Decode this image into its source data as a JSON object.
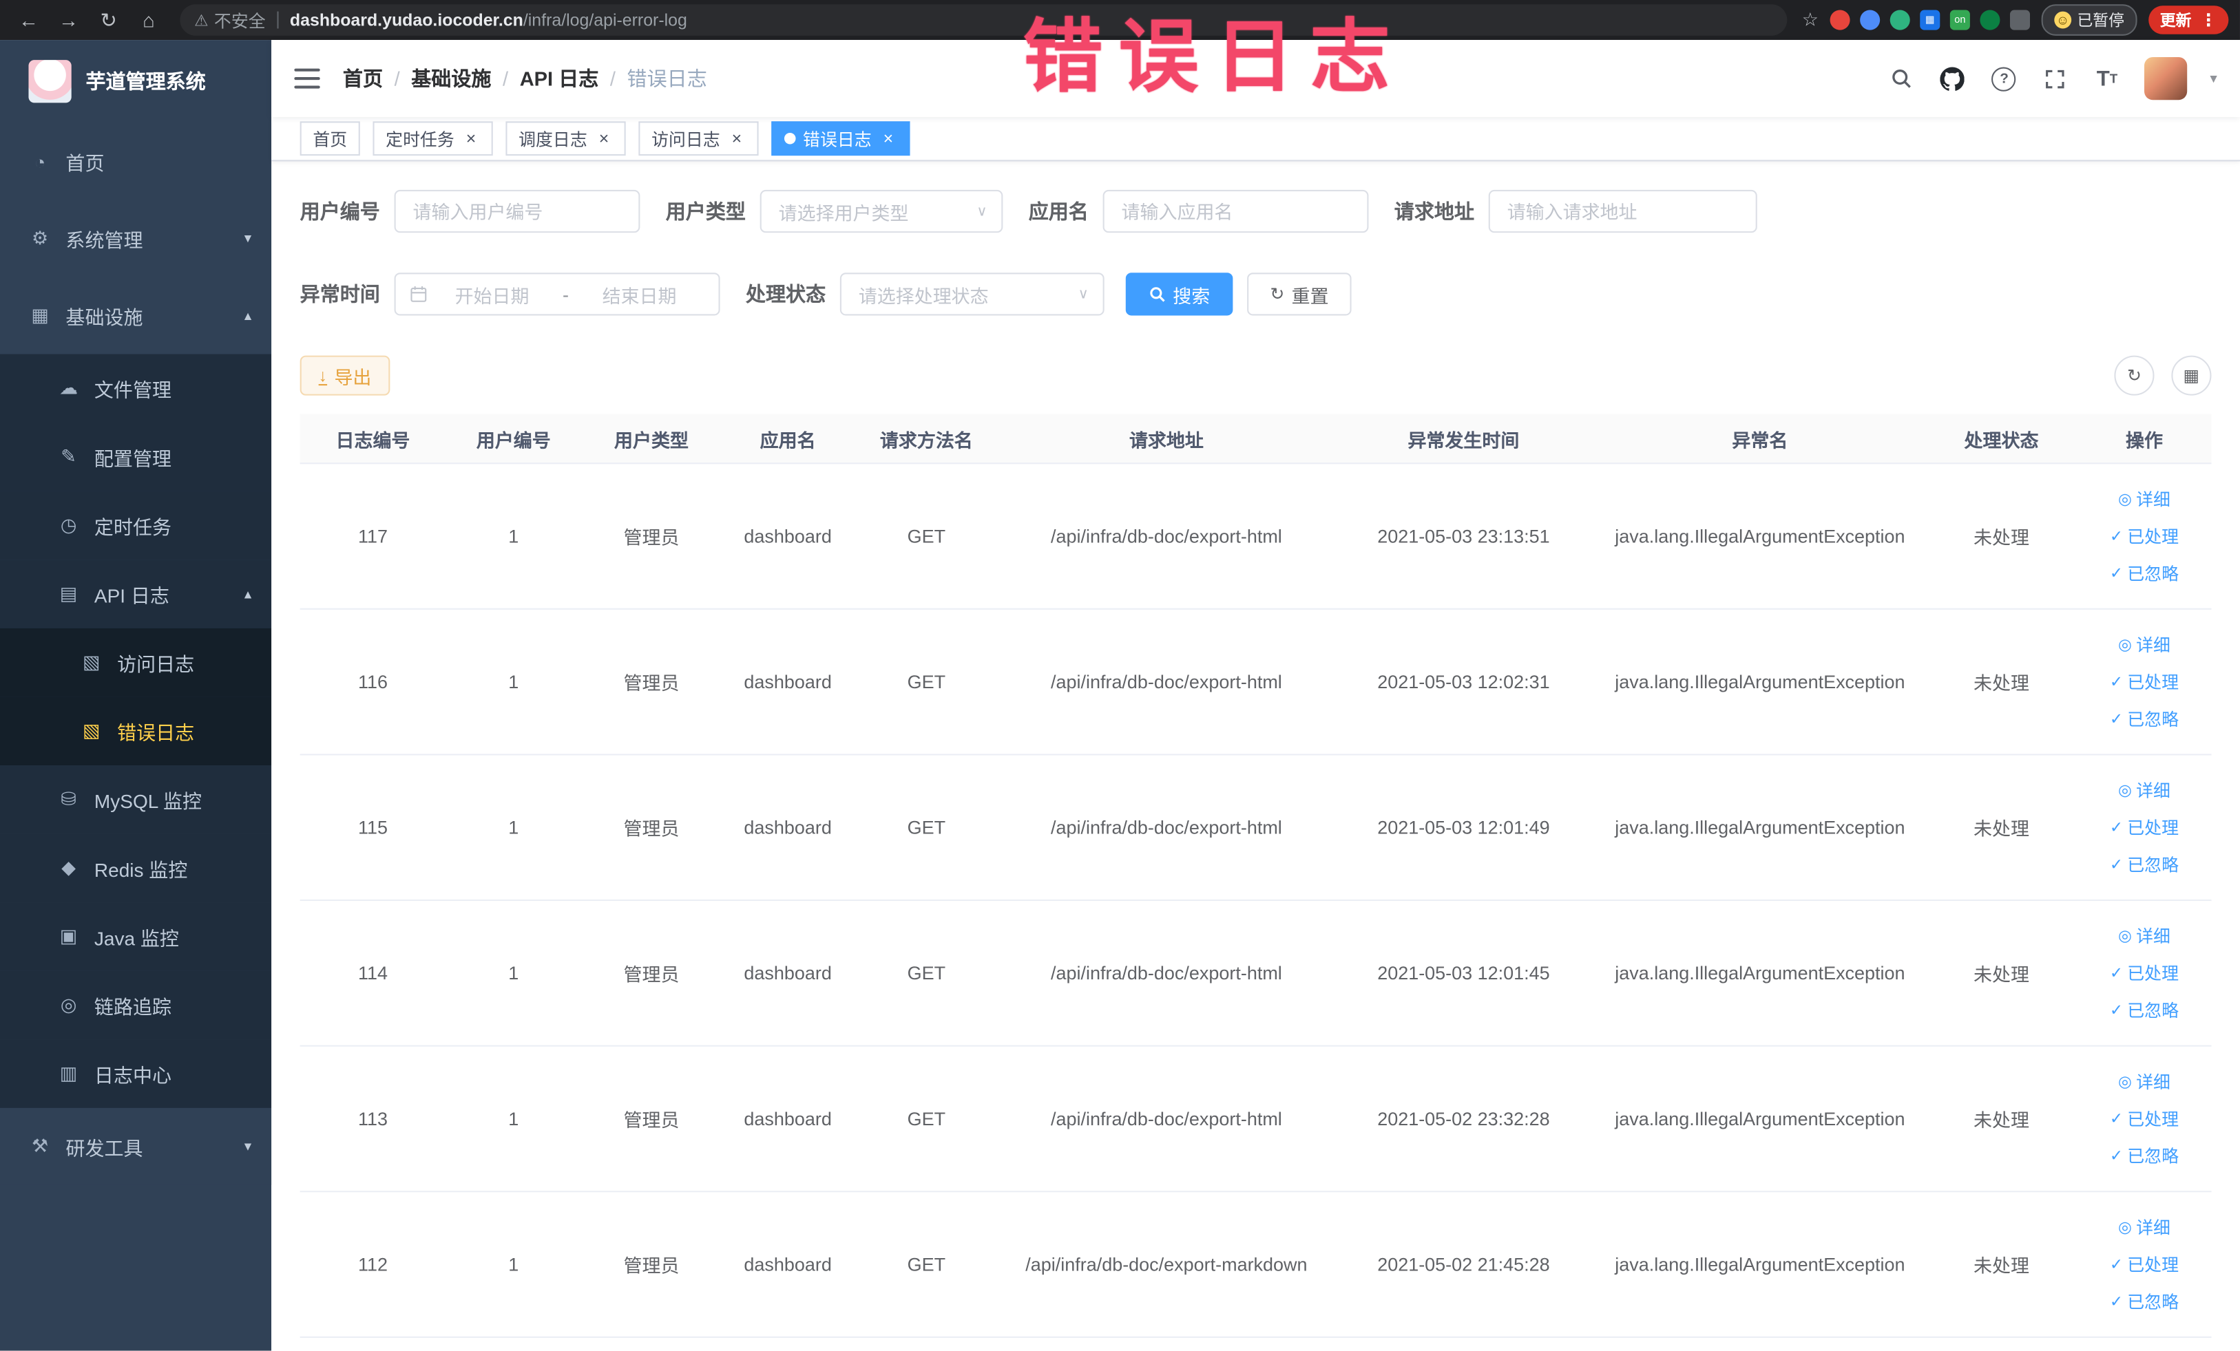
{
  "watermark": "错误日志",
  "colors": {
    "accent": "#409eff",
    "sidebar_bg": "#304156",
    "active_menu_text": "#ffd04b",
    "warning": "#e6a23c",
    "watermark_pink": "#f34769",
    "update_badge": "#d93025"
  },
  "browser": {
    "security_label": "不安全",
    "url_domain": "dashboard.yudao.iocoder.cn",
    "url_path": "/infra/log/api-error-log",
    "paused_badge": "已暂停",
    "update_button": "更新",
    "extensions": [
      "red-circle",
      "blue-drop",
      "green-circle",
      "blue-grid",
      "green-on-toggle",
      "green-leaf",
      "gray-puzzle"
    ]
  },
  "sidebar": {
    "logo_title": "芋道管理系统",
    "menu": [
      {
        "key": "home",
        "label": "首页",
        "icon": "home",
        "level": 1
      },
      {
        "key": "system",
        "label": "系统管理",
        "icon": "gear",
        "level": 1,
        "chevron": "down"
      },
      {
        "key": "infra",
        "label": "基础设施",
        "icon": "infra",
        "level": 1,
        "chevron": "up"
      },
      {
        "key": "file",
        "label": "文件管理",
        "icon": "cloud",
        "level": 2
      },
      {
        "key": "config",
        "label": "配置管理",
        "icon": "edit",
        "level": 2
      },
      {
        "key": "job",
        "label": "定时任务",
        "icon": "clock",
        "level": 2
      },
      {
        "key": "api-log",
        "label": "API 日志",
        "icon": "doc",
        "level": 2,
        "chevron": "up"
      },
      {
        "key": "access-log",
        "label": "访问日志",
        "icon": "form",
        "level": 3
      },
      {
        "key": "error-log",
        "label": "错误日志",
        "icon": "form",
        "level": 3,
        "active": true
      },
      {
        "key": "mysql",
        "label": "MySQL 监控",
        "icon": "db",
        "level": 2
      },
      {
        "key": "redis",
        "label": "Redis 监控",
        "icon": "redis",
        "level": 2
      },
      {
        "key": "java",
        "label": "Java 监控",
        "icon": "java",
        "level": 2
      },
      {
        "key": "trace",
        "label": "链路追踪",
        "icon": "eye",
        "level": 2
      },
      {
        "key": "log-center",
        "label": "日志中心",
        "icon": "log",
        "level": 2
      },
      {
        "key": "dev-tools",
        "label": "研发工具",
        "icon": "tools",
        "level": 1,
        "chevron": "down"
      }
    ]
  },
  "navbar": {
    "breadcrumb": [
      "首页",
      "基础设施",
      "API 日志",
      "错误日志"
    ]
  },
  "tags": [
    {
      "label": "首页",
      "closable": false,
      "active": false
    },
    {
      "label": "定时任务",
      "closable": true,
      "active": false
    },
    {
      "label": "调度日志",
      "closable": true,
      "active": false
    },
    {
      "label": "访问日志",
      "closable": true,
      "active": false
    },
    {
      "label": "错误日志",
      "closable": true,
      "active": true
    }
  ],
  "filters": {
    "user_id": {
      "label": "用户编号",
      "placeholder": "请输入用户编号"
    },
    "user_type": {
      "label": "用户类型",
      "placeholder": "请选择用户类型"
    },
    "app_name": {
      "label": "应用名",
      "placeholder": "请输入应用名"
    },
    "request_url": {
      "label": "请求地址",
      "placeholder": "请输入请求地址"
    },
    "exception_time": {
      "label": "异常时间",
      "start_placeholder": "开始日期",
      "separator": "-",
      "end_placeholder": "结束日期"
    },
    "process_status": {
      "label": "处理状态",
      "placeholder": "请选择处理状态"
    },
    "search_label": "搜索",
    "reset_label": "重置"
  },
  "toolbar": {
    "export_label": "导出"
  },
  "table": {
    "headers": [
      "日志编号",
      "用户编号",
      "用户类型",
      "应用名",
      "请求方法名",
      "请求地址",
      "异常发生时间",
      "异常名",
      "处理状态",
      "操作"
    ],
    "actions": [
      "详细",
      "已处理",
      "已忽略"
    ],
    "rows": [
      {
        "id": "117",
        "user_id": "1",
        "user_type": "管理员",
        "app_name": "dashboard",
        "method": "GET",
        "url": "/api/infra/db-doc/export-html",
        "time": "2021-05-03 23:13:51",
        "exception": "java.lang.IllegalArgumentException",
        "status": "未处理"
      },
      {
        "id": "116",
        "user_id": "1",
        "user_type": "管理员",
        "app_name": "dashboard",
        "method": "GET",
        "url": "/api/infra/db-doc/export-html",
        "time": "2021-05-03 12:02:31",
        "exception": "java.lang.IllegalArgumentException",
        "status": "未处理"
      },
      {
        "id": "115",
        "user_id": "1",
        "user_type": "管理员",
        "app_name": "dashboard",
        "method": "GET",
        "url": "/api/infra/db-doc/export-html",
        "time": "2021-05-03 12:01:49",
        "exception": "java.lang.IllegalArgumentException",
        "status": "未处理"
      },
      {
        "id": "114",
        "user_id": "1",
        "user_type": "管理员",
        "app_name": "dashboard",
        "method": "GET",
        "url": "/api/infra/db-doc/export-html",
        "time": "2021-05-03 12:01:45",
        "exception": "java.lang.IllegalArgumentException",
        "status": "未处理"
      },
      {
        "id": "113",
        "user_id": "1",
        "user_type": "管理员",
        "app_name": "dashboard",
        "method": "GET",
        "url": "/api/infra/db-doc/export-html",
        "time": "2021-05-02 23:32:28",
        "exception": "java.lang.IllegalArgumentException",
        "status": "未处理"
      },
      {
        "id": "112",
        "user_id": "1",
        "user_type": "管理员",
        "app_name": "dashboard",
        "method": "GET",
        "url": "/api/infra/db-doc/export-markdown",
        "time": "2021-05-02 21:45:28",
        "exception": "java.lang.IllegalArgumentException",
        "status": "未处理"
      }
    ]
  }
}
